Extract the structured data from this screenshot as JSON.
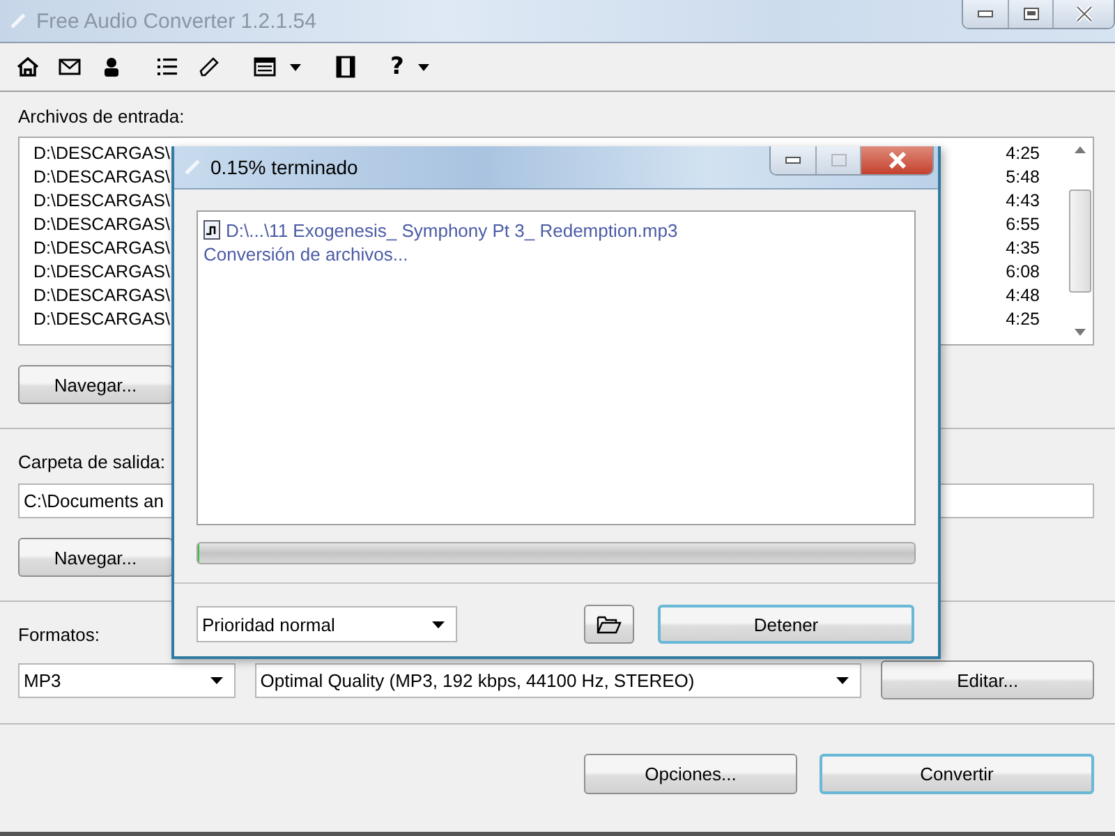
{
  "window": {
    "title": "Free Audio Converter 1.2.1.54"
  },
  "toolbar": {
    "help_label": "?"
  },
  "input_files": {
    "label": "Archivos de entrada:",
    "rows": [
      {
        "path": "D:\\DESCARGAS\\",
        "duration": "4:25"
      },
      {
        "path": "D:\\DESCARGAS\\",
        "duration": "5:48"
      },
      {
        "path": "D:\\DESCARGAS\\",
        "duration": "4:43"
      },
      {
        "path": "D:\\DESCARGAS\\",
        "duration": "6:55"
      },
      {
        "path": "D:\\DESCARGAS\\",
        "duration": "4:35"
      },
      {
        "path": "D:\\DESCARGAS\\",
        "duration": "6:08"
      },
      {
        "path": "D:\\DESCARGAS\\",
        "duration": "4:48"
      },
      {
        "path": "D:\\DESCARGAS\\",
        "duration": "4:25"
      }
    ],
    "browse_button": "Navegar..."
  },
  "output": {
    "label": "Carpeta de salida:",
    "value": "C:\\Documents an",
    "browse_button": "Navegar..."
  },
  "formats": {
    "label": "Formatos:",
    "format": "MP3",
    "quality": "Optimal Quality (MP3, 192 kbps, 44100 Hz, STEREO)",
    "edit_button": "Editar..."
  },
  "buttons": [
    {
      "label": "Opciones...",
      "default": false
    },
    {
      "label": "Convertir",
      "default": true
    }
  ],
  "dialog": {
    "title": "0.15% terminado",
    "file": "D:\\...\\11 Exogenesis_ Symphony Pt 3_ Redemption.mp3",
    "status": "Conversión de archivos...",
    "progress": {
      "level": 0.0015
    },
    "priority": "Prioridad normal",
    "stop_button": {
      "label": "Detener",
      "default": true
    }
  }
}
